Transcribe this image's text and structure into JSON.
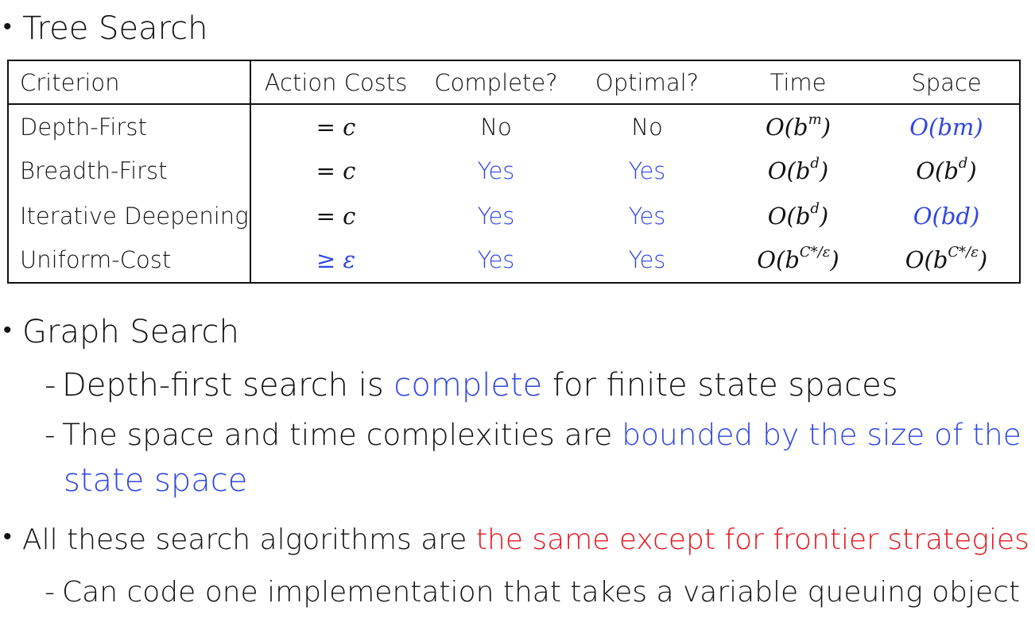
{
  "tree_search": {
    "bullet": "•",
    "heading": "Tree Search"
  },
  "table": {
    "headers": [
      "Criterion",
      "Action Costs",
      "Complete?",
      "Optimal?",
      "Time",
      "Space"
    ],
    "rows": [
      {
        "criterion": "Depth-First",
        "cost": "= c",
        "complete": "No",
        "optimal": "No",
        "time_base": "O(b",
        "time_exp": "m",
        "time_close": ")",
        "space_base": "O(bm)",
        "space_exp": "",
        "space_close": ""
      },
      {
        "criterion": "Breadth-First",
        "cost": "= c",
        "complete": "Yes",
        "optimal": "Yes",
        "time_base": "O(b",
        "time_exp": "d",
        "time_close": ")",
        "space_base": "O(b",
        "space_exp": "d",
        "space_close": ")"
      },
      {
        "criterion": "Iterative Deepening",
        "cost": "= c",
        "complete": "Yes",
        "optimal": "Yes",
        "time_base": "O(b",
        "time_exp": "d",
        "time_close": ")",
        "space_base": "O(bd)",
        "space_exp": "",
        "space_close": ""
      },
      {
        "criterion": "Uniform-Cost",
        "cost": "≥ ε",
        "complete": "Yes",
        "optimal": "Yes",
        "time_base": "O(b",
        "time_exp": "C*/ε",
        "time_close": ")",
        "space_base": "O(b",
        "space_exp": "C*/ε",
        "space_close": ")"
      }
    ]
  },
  "graph_search": {
    "bullet": "•",
    "heading": "Graph Search",
    "dash": "-",
    "line1_pre": "Depth-first search is ",
    "line1_hl": "complete",
    "line1_post": " for finite state spaces",
    "line2_pre": "The space and time complexities are ",
    "line2_hl": "bounded by the size of the",
    "line2_cont": "state space"
  },
  "all_algorithms": {
    "bullet": "•",
    "pre": "All these search algorithms are ",
    "hl": "the same except for frontier strategies",
    "dash": "-",
    "sub": "Can code one implementation that takes a variable queuing object"
  },
  "colors": {
    "blue": "#2e46e6",
    "red": "#e8141b",
    "text": "#111111"
  }
}
